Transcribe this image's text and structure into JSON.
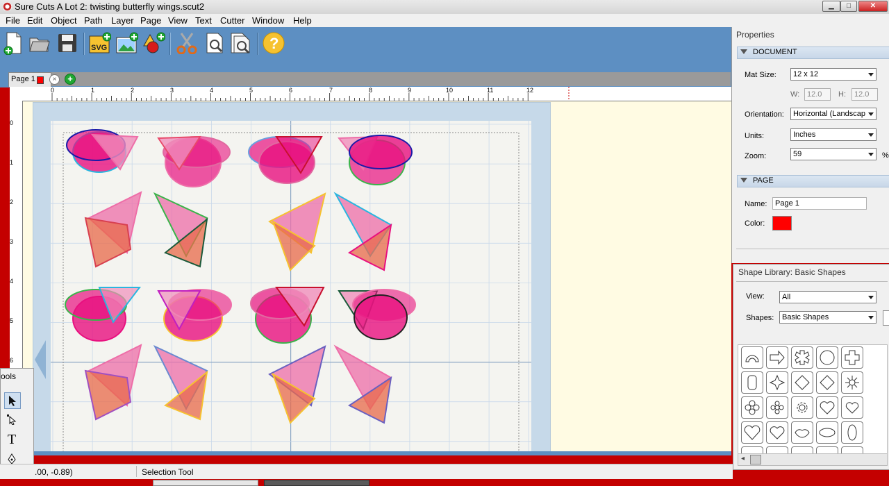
{
  "window": {
    "title": "Sure Cuts A Lot 2: twisting butterfly wings.scut2",
    "controls": [
      "▁",
      "□",
      "✕"
    ]
  },
  "menu": [
    "File",
    "Edit",
    "Object",
    "Path",
    "Layer",
    "Page",
    "View",
    "Text",
    "Cutter",
    "Window",
    "Help"
  ],
  "toolbar": {
    "svg_label": "SVG",
    "icons": [
      "new-document-icon",
      "open-folder-icon",
      "save-icon",
      "import-svg-icon",
      "import-image-icon",
      "add-shape-icon",
      "cut-scissors-icon",
      "preview-icon",
      "cut-preview-icon",
      "help-icon"
    ]
  },
  "tabs": {
    "page_tab_label": "Page 1",
    "close_glyph": "×",
    "add_glyph": "+"
  },
  "ruler": {
    "top_ticks": [
      "0",
      "1",
      "2",
      "3",
      "4",
      "5",
      "6",
      "7",
      "8",
      "9",
      "10",
      "11",
      "12"
    ],
    "left_ticks": [
      "0",
      "1",
      "2",
      "3",
      "4",
      "5",
      "6"
    ]
  },
  "status": {
    "coords": ".00, -0.89)",
    "tool": "Selection Tool"
  },
  "tools_panel": {
    "title": "ools"
  },
  "properties": {
    "title": "Properties",
    "document_section": "DOCUMENT",
    "mat_size_label": "Mat Size:",
    "mat_size_value": "12 x 12",
    "w_label": "W:",
    "w_value": "12.0",
    "h_label": "H:",
    "h_value": "12.0",
    "orientation_label": "Orientation:",
    "orientation_value": "Horizontal (Landscap",
    "units_label": "Units:",
    "units_value": "Inches",
    "zoom_label": "Zoom:",
    "zoom_value": "59",
    "zoom_unit": "%",
    "page_section": "PAGE",
    "name_label": "Name:",
    "name_value": "Page 1",
    "color_label": "Color:",
    "page_color": "#ff0000"
  },
  "shape_library": {
    "title": "Shape Library: Basic Shapes",
    "view_label": "View:",
    "view_value": "All",
    "shapes_label": "Shapes:",
    "shapes_value": "Basic Shapes",
    "items": [
      "arc",
      "arrow",
      "cross-burst",
      "circle",
      "cross",
      "rounded-rect",
      "star-4",
      "diamond",
      "diamond-2",
      "flower-burst",
      "flower-6",
      "flower-small",
      "gear",
      "heart",
      "heart-outline",
      "heart-2",
      "heart-3",
      "lips",
      "ellipse",
      "ellipse-vertical"
    ]
  },
  "colors": {
    "toolbar_bg": "#5d8fc2",
    "canvas_bg": "#fffbe3",
    "mat_bg": "#c6d9e9",
    "wing_pink": "#e8107f",
    "wing_light": "#ee6ea8"
  }
}
